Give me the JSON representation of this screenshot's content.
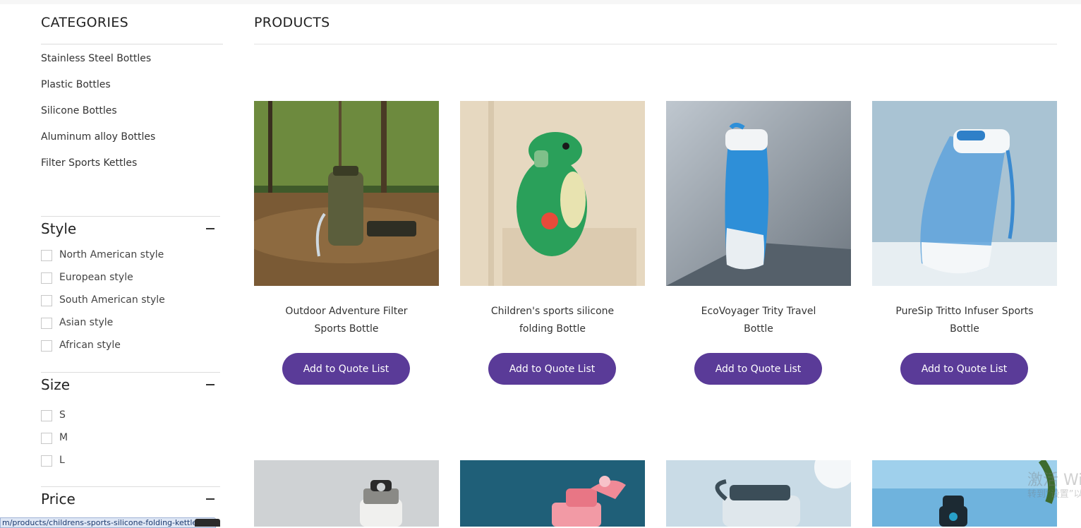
{
  "sidebar": {
    "categories_title": "CATEGORIES",
    "categories": [
      "Stainless Steel Bottles",
      "Plastic Bottles",
      "Silicone Bottles",
      "Aluminum alloy Bottles",
      "Filter Sports Kettles"
    ],
    "style": {
      "title": "Style",
      "options": [
        "North American style",
        "European style",
        "South American style",
        "Asian style",
        "African style"
      ]
    },
    "size": {
      "title": "Size",
      "options": [
        "S",
        "M",
        "L"
      ]
    },
    "price": {
      "title": "Price"
    }
  },
  "main": {
    "title": "PRODUCTS",
    "products": [
      {
        "name_line1": "Outdoor Adventure Filter",
        "name_line2": "Sports Bottle",
        "button": "Add to Quote List"
      },
      {
        "name_line1": "Children's sports silicone",
        "name_line2": "folding Bottle",
        "button": "Add to Quote List"
      },
      {
        "name_line1": "EcoVoyager Trity Travel",
        "name_line2": "Bottle",
        "button": "Add to Quote List"
      },
      {
        "name_line1": "PureSip Tritto Infuser Sports",
        "name_line2": "Bottle",
        "button": "Add to Quote List"
      }
    ]
  },
  "status_bar": {
    "url": "m/products/childrens-sports-silicone-folding-kettle"
  },
  "watermark": {
    "line1": "激活 Win",
    "line2": "转到“设置”以"
  },
  "colors": {
    "accent": "#5a3b98",
    "rule": "#dcdcdc"
  }
}
